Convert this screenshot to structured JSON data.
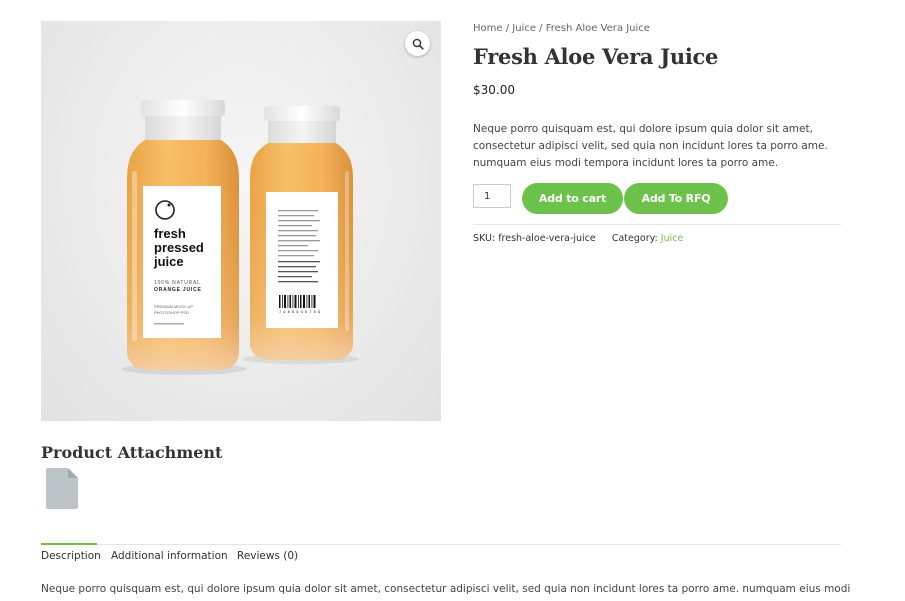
{
  "breadcrumb": {
    "home": "Home",
    "sep1": " / ",
    "category": "Juice",
    "sep2": " / ",
    "current": "Fresh Aloe Vera Juice"
  },
  "product": {
    "title": "Fresh Aloe Vera Juice",
    "price": "$30.00",
    "short_description": "Neque porro quisquam est, qui dolore ipsum quia dolor sit amet, consectetur adipisci velit, sed quia non incidunt lores ta porro ame. numquam eius modi tempora incidunt lores ta porro ame.",
    "quantity": "1",
    "add_to_cart_label": "Add to cart",
    "add_to_rfq_label": "Add To RFQ",
    "sku_label": "SKU: ",
    "sku": "fresh-aloe-vera-juice",
    "category_label": "Category: ",
    "category": "Juice"
  },
  "image": {
    "label_main": [
      "fresh",
      "pressed",
      "juice"
    ],
    "label_sub1": "100% NATURAL",
    "label_sub2": "ORANGE JUICE",
    "label_small1": "PREMIUM MOCK-UP",
    "label_small2": "PHOTOSHOP PSD",
    "barcode_number": "7 9 8 8 9 4 8 7 8 9"
  },
  "attachment": {
    "title": "Product Attachment"
  },
  "tabs": [
    {
      "label": "Description"
    },
    {
      "label": "Additional information"
    },
    {
      "label": "Reviews (0)"
    }
  ],
  "tab_body": "Neque porro quisquam est, qui dolore ipsum quia dolor sit amet, consectetur adipisci velit, sed quia non incidunt lores ta porro ame. numquam eius modi",
  "colors": {
    "accent": "#6dc24b",
    "juice": "#f2a43a"
  }
}
